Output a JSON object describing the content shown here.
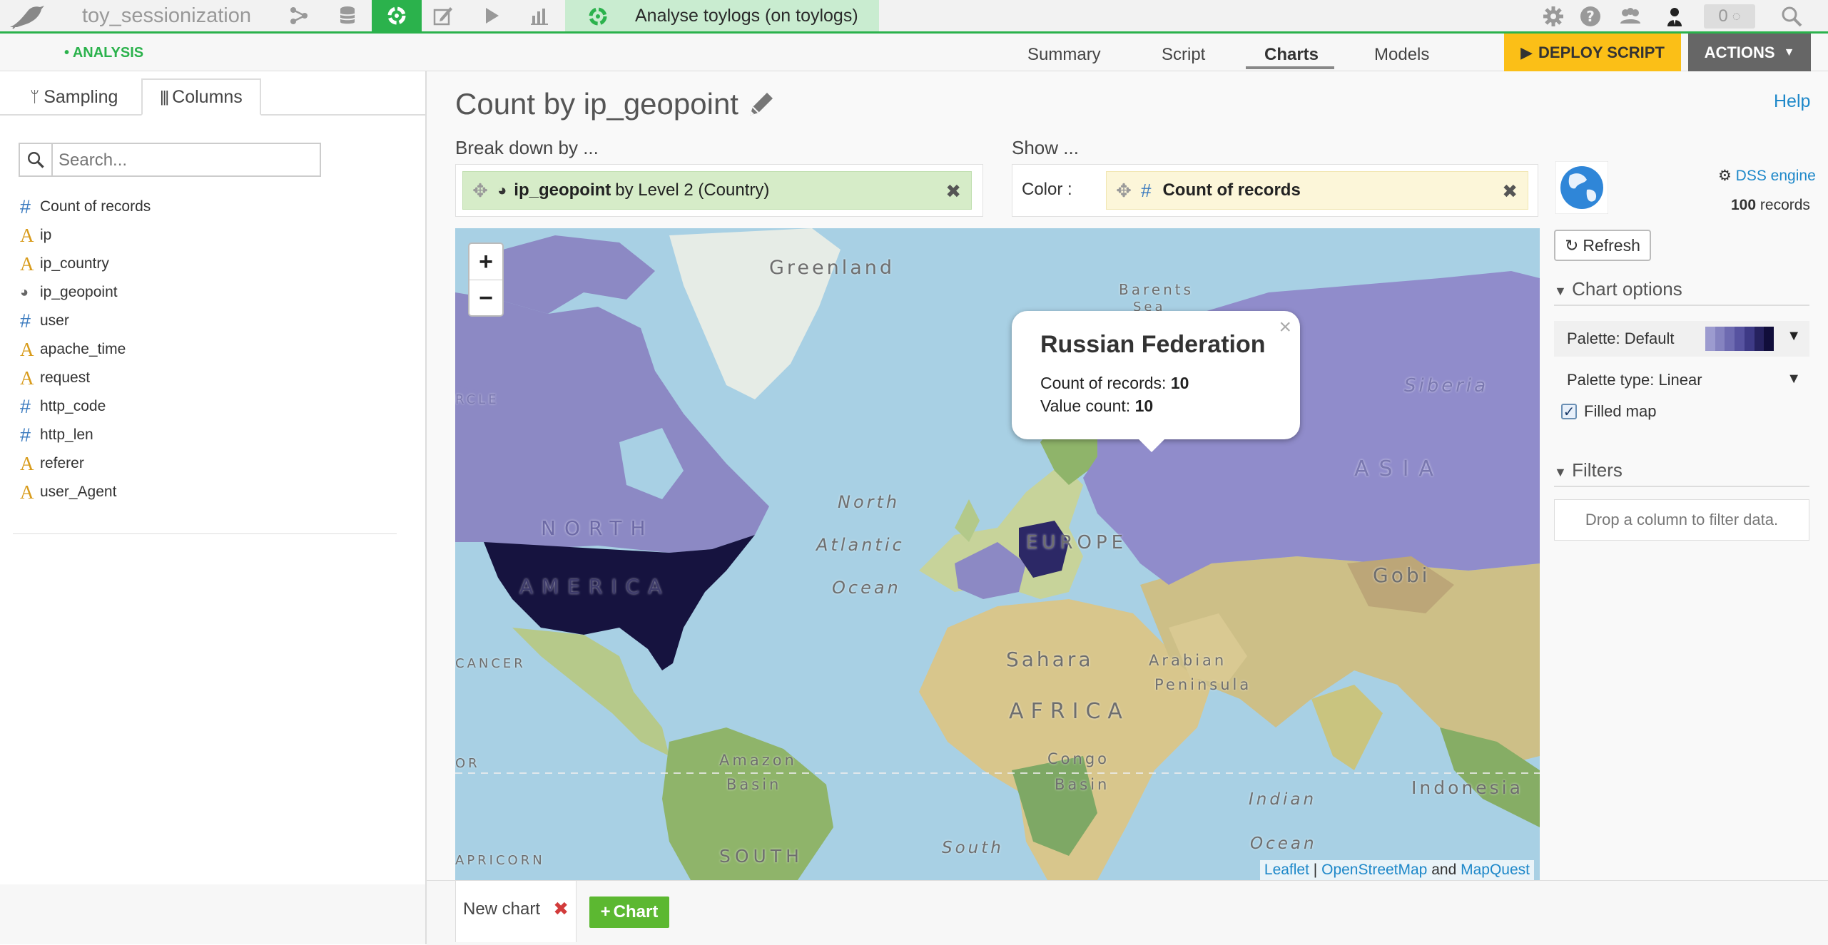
{
  "topbar": {
    "project_name": "toy_sessionization",
    "breadcrumb": "Analyse toylogs (on toylogs)",
    "notifications": "0",
    "icons": [
      "flow-icon",
      "datasets-icon",
      "analysis-icon",
      "notebook-icon",
      "jobs-icon",
      "dashboard-icon"
    ]
  },
  "subbar": {
    "section": "• ANALYSIS",
    "tabs": [
      "Summary",
      "Script",
      "Charts",
      "Models"
    ],
    "active_tab": "Charts",
    "deploy_label": "DEPLOY SCRIPT",
    "actions_label": "ACTIONS"
  },
  "left": {
    "tabs": [
      "Sampling",
      "Columns"
    ],
    "active_tab": "Columns",
    "search_placeholder": "Search...",
    "columns": [
      {
        "type": "#",
        "name": "Count of records"
      },
      {
        "type": "A",
        "name": "ip"
      },
      {
        "type": "A",
        "name": "ip_country"
      },
      {
        "type": "geo",
        "name": "ip_geopoint"
      },
      {
        "type": "#",
        "name": "user"
      },
      {
        "type": "A",
        "name": "apache_time"
      },
      {
        "type": "A",
        "name": "request"
      },
      {
        "type": "#",
        "name": "http_code"
      },
      {
        "type": "#",
        "name": "http_len"
      },
      {
        "type": "A",
        "name": "referer"
      },
      {
        "type": "A",
        "name": "user_Agent"
      }
    ]
  },
  "chart": {
    "title": "Count by ip_geopoint",
    "help": "Help",
    "breakdown_label": "Break down by ...",
    "breakdown_field": "ip_geopoint",
    "breakdown_suffix": "by Level 2 (Country)",
    "show_label": "Show ...",
    "color_label": "Color :",
    "show_field": "Count of records"
  },
  "map": {
    "labels": {
      "greenland": "Greenland",
      "barents": "Barents",
      "barents2": "Sea",
      "siberia": "Siberia",
      "asia": "ASIA",
      "north": "NORTH",
      "america": "AMERICA",
      "north_atl1": "North",
      "north_atl2": "Atlantic",
      "north_atl3": "Ocean",
      "europe": "EUROPE",
      "gobi": "Gobi",
      "sahara": "Sahara",
      "arabian1": "Arabian",
      "arabian2": "Peninsula",
      "africa": "AFRICA",
      "congo1": "Congo",
      "congo2": "Basin",
      "amazon1": "Amazon",
      "amazon2": "Basin",
      "indian1": "Indian",
      "indian2": "Ocean",
      "indonesia": "Indonesia",
      "south_atl": "South",
      "south": "SOUTH",
      "cancer": "CANCER",
      "capricorn": "APRICORN",
      "equator": "OR",
      "circle": "RCLE"
    },
    "zoom_in": "+",
    "zoom_out": "−",
    "popup": {
      "country": "Russian Federation",
      "line1_label": "Count of records: ",
      "line1_value": "10",
      "line2_label": "Value count: ",
      "line2_value": "10"
    },
    "attribution": {
      "leaflet": "Leaflet",
      "sep": "|",
      "osm": "OpenStreetMap",
      "and": "and",
      "mq": "MapQuest"
    }
  },
  "right": {
    "engine": "DSS engine",
    "records_count": "100",
    "records_label": "records",
    "refresh": "Refresh",
    "chart_options": "Chart options",
    "palette_label": "Palette:",
    "palette_value": "Default",
    "palette_colors": [
      "#9c9bcf",
      "#8583c0",
      "#6e6bb1",
      "#5753a0",
      "#3e3a86",
      "#26225f",
      "#110e3b"
    ],
    "palette_type_label": "Palette type:",
    "palette_type_value": "Linear",
    "filled_map": "Filled map",
    "filled_checked": true,
    "filters": "Filters",
    "drop_filter": "Drop a column to filter data."
  },
  "bottom": {
    "tab_label": "New chart",
    "add_label": "Chart"
  }
}
